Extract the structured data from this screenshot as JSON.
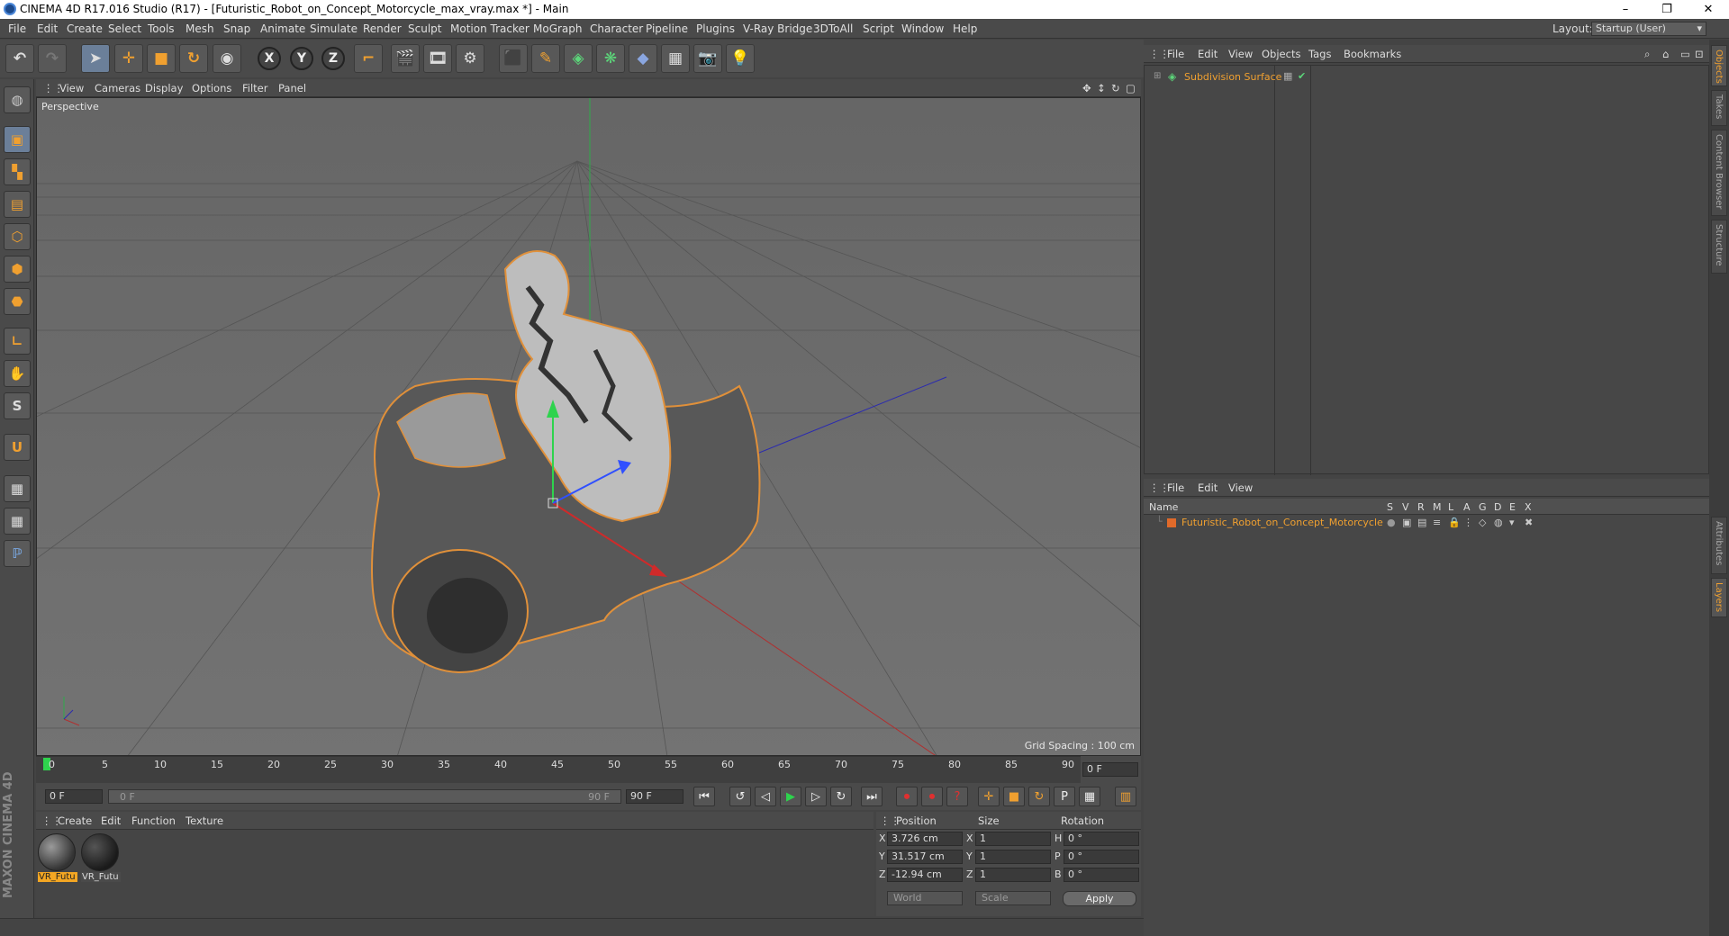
{
  "app": {
    "title": "CINEMA 4D R17.016 Studio (R17) - [Futuristic_Robot_on_Concept_Motorcycle_max_vray.max *] - Main",
    "window_controls": [
      "–",
      "❐",
      "✕"
    ]
  },
  "menu": [
    "File",
    "Edit",
    "Create",
    "Select",
    "Tools",
    "Mesh",
    "Snap",
    "Animate",
    "Simulate",
    "Render",
    "Sculpt",
    "Motion Tracker",
    "MoGraph",
    "Character",
    "Pipeline",
    "Plugins",
    "V-Ray Bridge",
    "3DToAll",
    "Script",
    "Window",
    "Help"
  ],
  "layout": {
    "label": "Layout:",
    "value": "Startup (User)"
  },
  "viewport": {
    "menu": [
      "View",
      "Cameras",
      "Display",
      "Options",
      "Filter",
      "Panel"
    ],
    "label": "Perspective",
    "grid_spacing": "Grid Spacing : 100 cm"
  },
  "timeline": {
    "ticks": [
      "0",
      "5",
      "10",
      "15",
      "20",
      "25",
      "30",
      "35",
      "40",
      "45",
      "50",
      "55",
      "60",
      "65",
      "70",
      "75",
      "80",
      "85",
      "90"
    ],
    "current_frame": "0 F"
  },
  "transport": {
    "start": "0 F",
    "range_start": "0 F",
    "range_end": "90 F",
    "end": "90 F"
  },
  "materials": {
    "menu": [
      "Create",
      "Edit",
      "Function",
      "Texture"
    ],
    "items": [
      "VR_Futu",
      "VR_Futu"
    ]
  },
  "coordinates": {
    "headers": [
      "Position",
      "Size",
      "Rotation"
    ],
    "rows": [
      {
        "axis": "X",
        "position": "3.726 cm",
        "size_axis": "X",
        "size": "1",
        "rot_axis": "H",
        "rotation": "0 °"
      },
      {
        "axis": "Y",
        "position": "31.517 cm",
        "size_axis": "Y",
        "size": "1",
        "rot_axis": "P",
        "rotation": "0 °"
      },
      {
        "axis": "Z",
        "position": "-12.94 cm",
        "size_axis": "Z",
        "size": "1",
        "rot_axis": "B",
        "rotation": "0 °"
      }
    ],
    "mode": "World",
    "size_mode": "Scale",
    "apply": "Apply"
  },
  "objects": {
    "menu": [
      "File",
      "Edit",
      "View",
      "Objects",
      "Tags",
      "Bookmarks"
    ],
    "items": [
      {
        "name": "Subdivision Surface"
      }
    ]
  },
  "layers": {
    "menu": [
      "File",
      "Edit",
      "View"
    ],
    "columns": [
      "Name",
      "S",
      "V",
      "R",
      "M",
      "L",
      "A",
      "G",
      "D",
      "E",
      "X"
    ],
    "items": [
      {
        "name": "Futuristic_Robot_on_Concept_Motorcycle"
      }
    ]
  },
  "right_tabs": [
    "Objects",
    "Takes",
    "Content Browser",
    "Structure",
    "Attributes",
    "Layers"
  ],
  "branding": "MAXON CINEMA 4D"
}
